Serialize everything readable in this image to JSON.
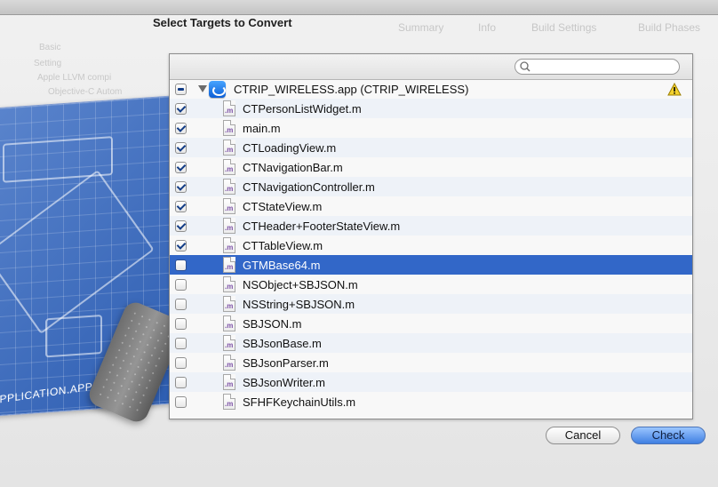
{
  "dialog": {
    "title": "Select Targets to Convert",
    "search_placeholder": "",
    "target": {
      "label": "CTRIP_WIRELESS.app (CTRIP_WIRELESS)",
      "state": "mixed",
      "warning": true
    },
    "files": [
      {
        "name": "CTPersonListWidget.m",
        "checked": true
      },
      {
        "name": "main.m",
        "checked": true
      },
      {
        "name": "CTLoadingView.m",
        "checked": true
      },
      {
        "name": "CTNavigationBar.m",
        "checked": true
      },
      {
        "name": "CTNavigationController.m",
        "checked": true
      },
      {
        "name": "CTStateView.m",
        "checked": true
      },
      {
        "name": "CTHeader+FooterStateView.m",
        "checked": true
      },
      {
        "name": "CTTableView.m",
        "checked": true
      },
      {
        "name": "GTMBase64.m",
        "checked": false,
        "selected": true
      },
      {
        "name": "NSObject+SBJSON.m",
        "checked": false
      },
      {
        "name": "NSString+SBJSON.m",
        "checked": false
      },
      {
        "name": "SBJSON.m",
        "checked": false
      },
      {
        "name": "SBJsonBase.m",
        "checked": false
      },
      {
        "name": "SBJsonParser.m",
        "checked": false
      },
      {
        "name": "SBJsonWriter.m",
        "checked": false
      },
      {
        "name": "SFHFKeychainUtils.m",
        "checked": false
      }
    ],
    "buttons": {
      "cancel": "Cancel",
      "check": "Check"
    }
  },
  "background": {
    "tabs": [
      "Summary",
      "Info",
      "Build Settings",
      "Build Phases"
    ],
    "toolbar_labels": [
      "Basic",
      "Setting",
      "Apple LLVM compi",
      "Objective-C Autom"
    ],
    "blueprint_footer": "APPLICATION.APP"
  },
  "colors": {
    "selection": "#3267c8",
    "primary_button": "#3f7fe2",
    "file_icon_text": "#7e53a8"
  }
}
